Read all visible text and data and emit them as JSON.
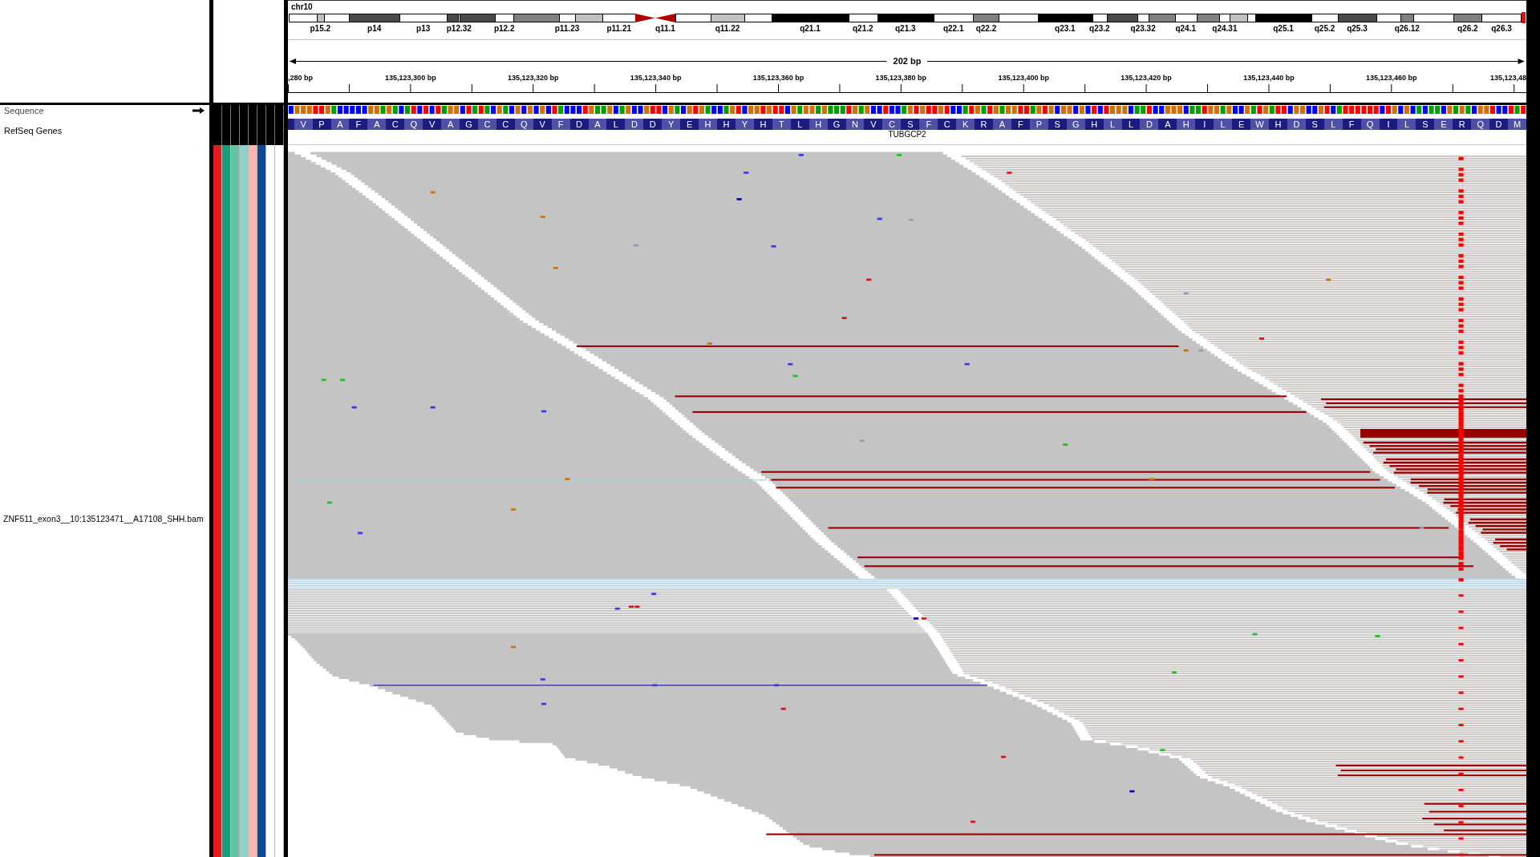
{
  "ideogram": {
    "chromosome": "chr10",
    "bands": [
      {
        "kind": "gneg"
      },
      {
        "kind": "gpos25",
        "label": "p15.2"
      },
      {
        "kind": "gneg"
      },
      {
        "kind": "gpos75",
        "label": "p14"
      },
      {
        "kind": "gneg",
        "label": "p13"
      },
      {
        "kind": "gpos75"
      },
      {
        "kind": "gneg",
        "label": "p12.32"
      },
      {
        "kind": "gpos75"
      },
      {
        "kind": "gneg",
        "label": "p12.2"
      },
      {
        "kind": "gpos50"
      },
      {
        "kind": "gneg",
        "label": "p11.23"
      },
      {
        "kind": "gpos25"
      },
      {
        "kind": "gneg",
        "label": "p11.21"
      },
      {
        "kind": "acen"
      },
      {
        "kind": "acen",
        "label": "q11.1"
      },
      {
        "kind": "gneg"
      },
      {
        "kind": "gpos25",
        "label": "q11.22"
      },
      {
        "kind": "gneg"
      },
      {
        "kind": "gpos100",
        "label": "q21.1"
      },
      {
        "kind": "gneg",
        "label": "q21.2"
      },
      {
        "kind": "gpos100",
        "label": "q21.3"
      },
      {
        "kind": "gneg",
        "label": "q22.1"
      },
      {
        "kind": "gpos50",
        "label": "q22.2"
      },
      {
        "kind": "gneg"
      },
      {
        "kind": "gpos100",
        "label": "q23.1"
      },
      {
        "kind": "gneg",
        "label": "q23.2"
      },
      {
        "kind": "gpos75"
      },
      {
        "kind": "gneg",
        "label": "q23.32"
      },
      {
        "kind": "gpos50"
      },
      {
        "kind": "gneg",
        "label": "q24.1"
      },
      {
        "kind": "gpos50"
      },
      {
        "kind": "gneg",
        "label": "q24.31"
      },
      {
        "kind": "gpos25"
      },
      {
        "kind": "gneg"
      },
      {
        "kind": "gpos100",
        "label": "q25.1"
      },
      {
        "kind": "gneg",
        "label": "q25.2"
      },
      {
        "kind": "gpos75",
        "label": "q25.3"
      },
      {
        "kind": "gneg"
      },
      {
        "kind": "gpos50",
        "label": "q26.12"
      },
      {
        "kind": "gneg"
      },
      {
        "kind": "gpos50",
        "label": "q26.2"
      },
      {
        "kind": "gneg",
        "label": "q26.3"
      }
    ]
  },
  "ruler": {
    "span": "202 bp",
    "tick_labels": [
      ",280 bp",
      "135,123,300 bp",
      "135,123,320 bp",
      "135,123,340 bp",
      "135,123,360 bp",
      "135,123,380 bp",
      "135,123,400 bp",
      "135,123,420 bp",
      "135,123,440 bp",
      "135,123,460 bp",
      "135,123,48"
    ]
  },
  "tracks": [
    {
      "kind": "sequence",
      "name": "Sequence"
    },
    {
      "kind": "genes",
      "name": "RefSeq Genes",
      "gene": {
        "name": "TUBGCP2",
        "amino_acids": [
          "V",
          "P",
          "A",
          "F",
          "A",
          "C",
          "Q",
          "V",
          "A",
          "G",
          "C",
          "C",
          "Q",
          "V",
          "F",
          "D",
          "A",
          "L",
          "D",
          "D",
          "Y",
          "E",
          "H",
          "H",
          "Y",
          "H",
          "T",
          "L",
          "H",
          "G",
          "N",
          "V",
          "C",
          "S",
          "F",
          "C",
          "K",
          "R",
          "A",
          "F",
          "P",
          "S",
          "G",
          "H",
          "L",
          "L",
          "D",
          "A",
          "H",
          "I",
          "L",
          "E",
          "W",
          "H",
          "D",
          "S",
          "L",
          "F",
          "Q",
          "I",
          "L",
          "S",
          "E",
          "R",
          "Q",
          "D",
          "M"
        ]
      }
    },
    {
      "kind": "alignments",
      "name": "ZNF511_exon3__10:135123471__A17108_SHH.bam",
      "attributes": [
        {
          "color": "#e41a1c"
        },
        {
          "color": "#1b9e77"
        },
        {
          "color": "#66c2a5"
        },
        {
          "color": "#8dd3c7"
        },
        {
          "color": "#fbb4ae"
        },
        {
          "color": "#0c4a96"
        },
        {
          "color": "#ffffff"
        },
        {
          "color": "#ffffff"
        }
      ]
    }
  ]
}
